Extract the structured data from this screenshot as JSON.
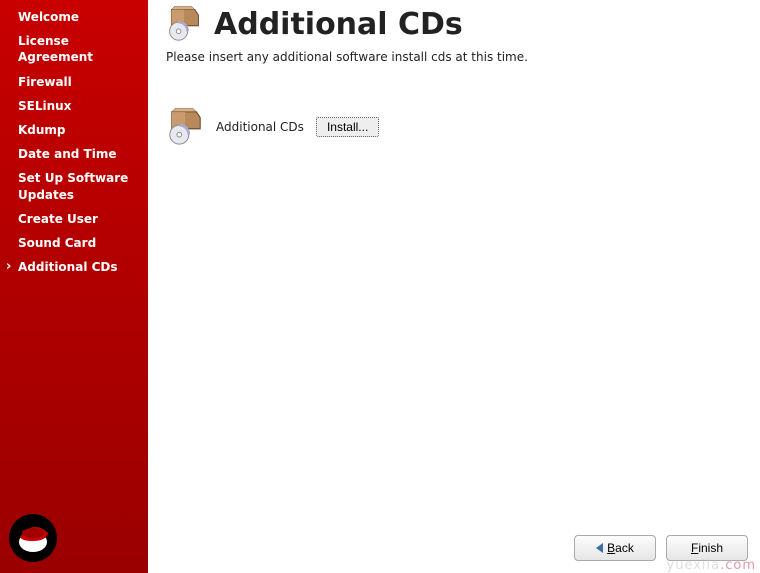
{
  "sidebar": {
    "items": [
      {
        "label": "Welcome",
        "active": false
      },
      {
        "label": "License Agreement",
        "active": false
      },
      {
        "label": "Firewall",
        "active": false
      },
      {
        "label": "SELinux",
        "active": false
      },
      {
        "label": "Kdump",
        "active": false
      },
      {
        "label": "Date and Time",
        "active": false
      },
      {
        "label": "Set Up Software Updates",
        "active": false
      },
      {
        "label": "Create User",
        "active": false
      },
      {
        "label": "Sound Card",
        "active": false
      },
      {
        "label": "Additional CDs",
        "active": true
      }
    ]
  },
  "header": {
    "title": "Additional CDs",
    "icon": "cd-box-icon"
  },
  "main": {
    "description": "Please insert any additional software install cds at this time.",
    "row_label": "Additional CDs",
    "install_button": "Install..."
  },
  "footer": {
    "back": "Back",
    "finish": "Finish"
  },
  "watermark": "yuexila.com"
}
